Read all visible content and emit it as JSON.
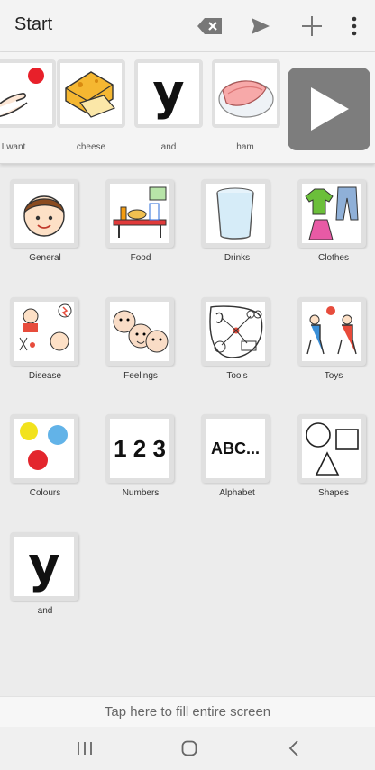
{
  "app": {
    "title": "Start"
  },
  "toolbar": {
    "backspace_icon": "backspace-icon",
    "send_icon": "send-icon",
    "add_icon": "plus-icon",
    "menu_icon": "more-vertical-icon"
  },
  "sentence": [
    {
      "label": "I want",
      "icon": "i-want-icon"
    },
    {
      "label": "cheese",
      "icon": "cheese-icon"
    },
    {
      "label": "and",
      "icon": "and-letter-icon",
      "glyph": "y"
    },
    {
      "label": "ham",
      "icon": "ham-icon"
    }
  ],
  "categories": [
    {
      "label": "General",
      "icon": "boy-face-icon"
    },
    {
      "label": "Food",
      "icon": "food-table-icon"
    },
    {
      "label": "Drinks",
      "icon": "glass-of-water-icon"
    },
    {
      "label": "Clothes",
      "icon": "clothes-icon"
    },
    {
      "label": "Disease",
      "icon": "disease-icon"
    },
    {
      "label": "Feelings",
      "icon": "feelings-faces-icon"
    },
    {
      "label": "Tools",
      "icon": "tools-icon"
    },
    {
      "label": "Toys",
      "icon": "toys-kids-icon"
    },
    {
      "label": "Colours",
      "icon": "paint-splash-icon"
    },
    {
      "label": "Numbers",
      "icon": "numbers-icon",
      "glyph": "1 2 3"
    },
    {
      "label": "Alphabet",
      "icon": "alphabet-icon",
      "glyph": "ABC..."
    },
    {
      "label": "Shapes",
      "icon": "shapes-icon"
    },
    {
      "label": "and",
      "icon": "and-letter-icon",
      "glyph": "y"
    }
  ],
  "footer": {
    "fill_screen": "Tap here to fill entire screen"
  },
  "navigation": {
    "recents_icon": "recents-icon",
    "home_icon": "home-icon",
    "back_icon": "back-icon"
  }
}
